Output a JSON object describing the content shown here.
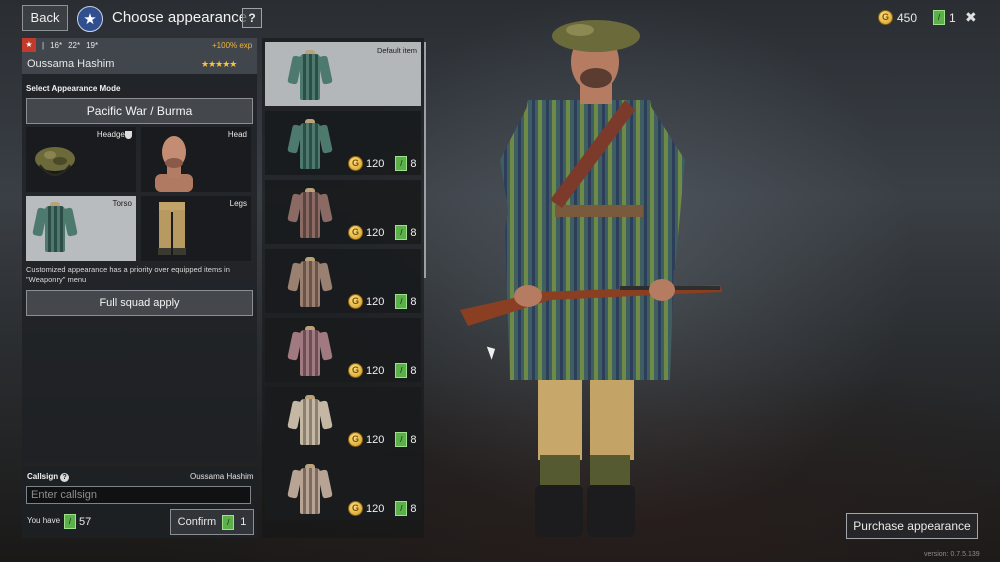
{
  "header": {
    "back_label": "Back",
    "star_icon": "★",
    "title": "Choose appearance",
    "help_label": "?",
    "gold_amount": "450",
    "tickets_amount": "1",
    "close_icon": "✖"
  },
  "soldier": {
    "flag_icon": "★",
    "stats": [
      "16*",
      "22*",
      "19*"
    ],
    "exp_bonus": "+100% exp",
    "name": "Oussama Hashim",
    "rating": "★★★★★"
  },
  "appearance": {
    "mode_label": "Select Appearance Mode",
    "mode_value": "Pacific War / Burma",
    "slots": [
      {
        "label": "Headgear"
      },
      {
        "label": "Head"
      },
      {
        "label": "Torso"
      },
      {
        "label": "Legs"
      }
    ],
    "note": "Customized appearance has a priority over equipped items in \"Weaponry\" menu",
    "squad_apply_label": "Full squad apply"
  },
  "callsign": {
    "label": "Callsign",
    "current_name": "Oussama Hashim",
    "placeholder": "Enter callsign",
    "you_have_label": "You have",
    "tickets": "57",
    "confirm_label": "Confirm",
    "confirm_cost": "1"
  },
  "items": {
    "default_label": "Default item",
    "list": [
      {
        "gold": "120",
        "tickets": "8",
        "color_a": "#4e7a6e",
        "color_b": "#2d4e47"
      },
      {
        "gold": "120",
        "tickets": "8",
        "color_a": "#8a6a62",
        "color_b": "#5a4440"
      },
      {
        "gold": "120",
        "tickets": "8",
        "color_a": "#9a8070",
        "color_b": "#6a5448"
      },
      {
        "gold": "120",
        "tickets": "8",
        "color_a": "#a07a80",
        "color_b": "#6c4e54"
      },
      {
        "gold": "120",
        "tickets": "8",
        "color_a": "#c4b8a4",
        "color_b": "#8e8070"
      },
      {
        "gold": "120",
        "tickets": "8",
        "color_a": "#b8a494",
        "color_b": "#7c6a5e"
      }
    ]
  },
  "purchase_label": "Purchase appearance",
  "version": "version: 0.7.5.139",
  "colors": {
    "accent_gold": "#f0b43a",
    "ticket_green": "#5bb04a",
    "selected_slot": "#b9bcbe"
  }
}
